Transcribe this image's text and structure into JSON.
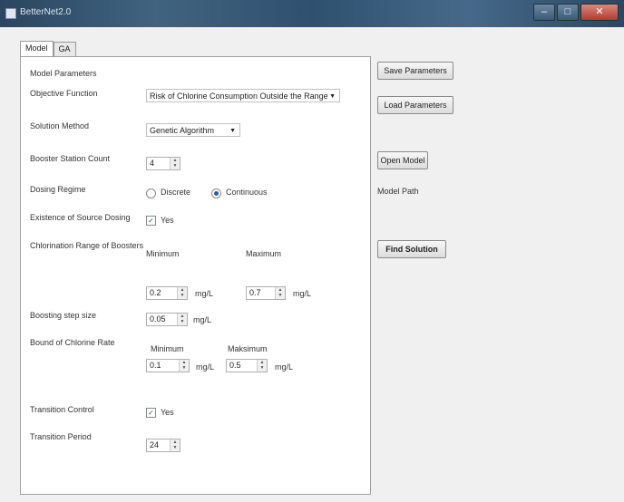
{
  "window": {
    "title": "BetterNet2.0"
  },
  "tabs": [
    {
      "label": "Model"
    },
    {
      "label": "GA"
    }
  ],
  "model": {
    "group_label": "Model Parameters",
    "objective_label": "Objective Function",
    "objective_value": "Risk of Chlorine Consumption Outside the Range",
    "solution_label": "Solution Method",
    "solution_value": "Genetic Algorithm",
    "booster_label": "Booster Station Count",
    "booster_value": "4",
    "dosing_label": "Dosing Regime",
    "dosing_discrete": "Discrete",
    "dosing_continuous": "Continuous",
    "source_label": "Existence of Source Dosing",
    "source_yes": "Yes",
    "range_label": "Chlorination Range of Boosters",
    "minimum": "Minimum",
    "maximum": "Maximum",
    "range_min": "0.2",
    "range_max": "0.7",
    "unit": "mg/L",
    "step_label": "Boosting step size",
    "step_value": "0.05",
    "bound_label": "Bound of Chlorine Rate",
    "bound_min_caption": "Minimum",
    "bound_max_caption": "Maksimum",
    "bound_min": "0.1",
    "bound_max": "0.5",
    "transition_label": "Transition Control",
    "transition_yes": "Yes",
    "period_label": "Transition Period",
    "period_value": "24"
  },
  "side": {
    "save": "Save Parameters",
    "load": "Load Parameters",
    "open": "Open Model",
    "model_path": "Model Path",
    "find": "Find Solution"
  }
}
